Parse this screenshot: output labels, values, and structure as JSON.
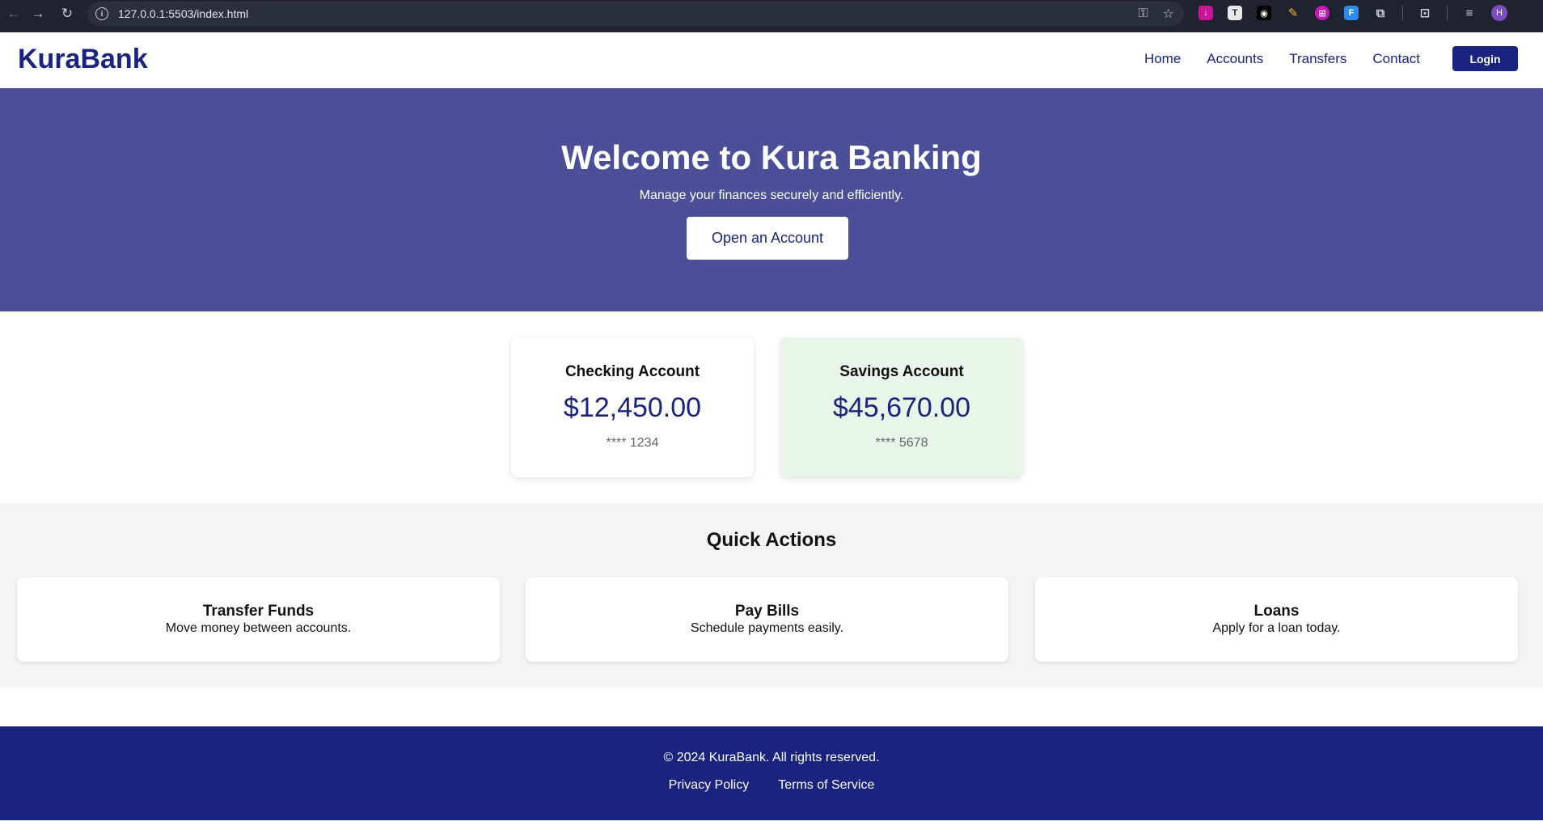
{
  "browser": {
    "url": "127.0.0.1:5503/index.html",
    "avatar_letter": "H"
  },
  "nav": {
    "logo": "KuraBank",
    "links": [
      "Home",
      "Accounts",
      "Transfers",
      "Contact"
    ],
    "login_label": "Login"
  },
  "hero": {
    "title": "Welcome to Kura Banking",
    "subtitle": "Manage your finances securely and efficiently.",
    "cta_label": "Open an Account"
  },
  "accounts": [
    {
      "title": "Checking Account",
      "balance": "$12,450.00",
      "number": "**** 1234",
      "background": "#ffffff"
    },
    {
      "title": "Savings Account",
      "balance": "$45,670.00",
      "number": "**** 5678",
      "background": "#e8f5e9"
    }
  ],
  "quick_actions": {
    "heading": "Quick Actions",
    "items": [
      {
        "title": "Transfer Funds",
        "description": "Move money between accounts."
      },
      {
        "title": "Pay Bills",
        "description": "Schedule payments easily."
      },
      {
        "title": "Loans",
        "description": "Apply for a loan today."
      }
    ]
  },
  "footer": {
    "copyright": "© 2024 KuraBank. All rights reserved.",
    "links": [
      "Privacy Policy",
      "Terms of Service"
    ]
  },
  "colors": {
    "primary": "#1a237e",
    "hero_bg": "#4a4f98",
    "section_bg": "#f4f4f4"
  }
}
